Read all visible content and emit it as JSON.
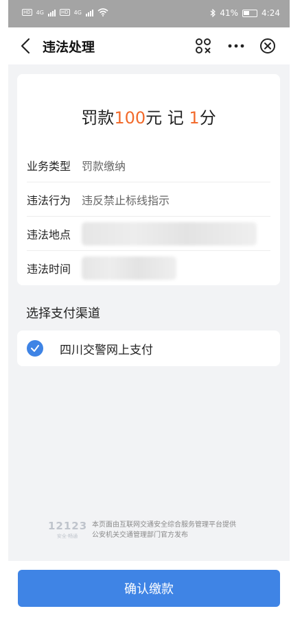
{
  "status_bar": {
    "network_a": "4G",
    "network_b": "4G",
    "sim_a": "HD",
    "sim_b": "HD",
    "battery": "41%",
    "time": "4:24"
  },
  "nav": {
    "title": "违法处理"
  },
  "summary": {
    "prefix": "罚款",
    "fine_amount": "100",
    "fine_unit": "元 记",
    "points": "1",
    "points_unit": "分"
  },
  "details": {
    "rows": [
      {
        "label": "业务类型",
        "value": "罚款缴纳"
      },
      {
        "label": "违法行为",
        "value": "违反禁止标线指示"
      },
      {
        "label": "违法地点",
        "value": ""
      },
      {
        "label": "违法时间",
        "value": ""
      }
    ]
  },
  "payment": {
    "section_title": "选择支付渠道",
    "option_label": "四川交警网上支付",
    "selected": true
  },
  "footer": {
    "logo_number": "12123",
    "logo_slogan": "安全·畅通",
    "line1": "本页面由互联网交通安全综合服务管理平台提供",
    "line2": "公安机关交通管理部门官方发布"
  },
  "actions": {
    "confirm_label": "确认缴款"
  },
  "colors": {
    "accent_orange": "#f26a2b",
    "primary_blue": "#3f84e5",
    "status_bar_gray": "#a4a4a4"
  }
}
